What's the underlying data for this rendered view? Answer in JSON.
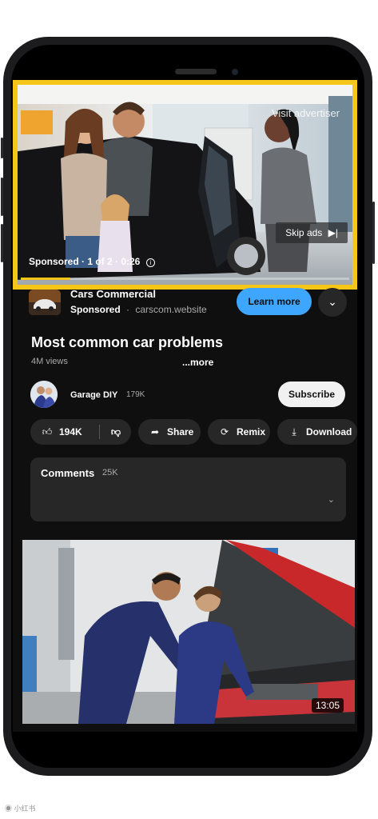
{
  "ad": {
    "visit_label": "Visit advertiser",
    "skip_label": "Skip ads",
    "skip_icon": "skip-next-icon",
    "status": "Sponsored · 1 of 2 · 0:26",
    "info_icon": "info-icon",
    "progress_fraction": 0.15,
    "highlight_color": "#f5c518"
  },
  "ad_info": {
    "title": "Cars Commercial",
    "sponsored": "Sponsored",
    "separator": "·",
    "website": "carscom.website",
    "learn_more": "Learn more",
    "expand_icon": "chevron-down-icon",
    "accent_color": "#3ea6ff"
  },
  "video": {
    "title": "Most common car problems",
    "views": "4M views",
    "more": "...more"
  },
  "channel": {
    "name": "Garage DIY",
    "subscribers": "179K",
    "subscribe_label": "Subscribe"
  },
  "actions": {
    "likes": "194K",
    "like_icon": "thumbs-up-icon",
    "dislike_icon": "thumbs-down-icon",
    "share": "Share",
    "share_icon": "share-icon",
    "remix": "Remix",
    "remix_icon": "remix-icon",
    "download": "Download",
    "download_icon": "download-icon"
  },
  "comments": {
    "label": "Comments",
    "count": "25K",
    "expand_icon": "chevron-down-icon"
  },
  "next_video": {
    "duration": "13:05"
  },
  "watermark": "小红书"
}
